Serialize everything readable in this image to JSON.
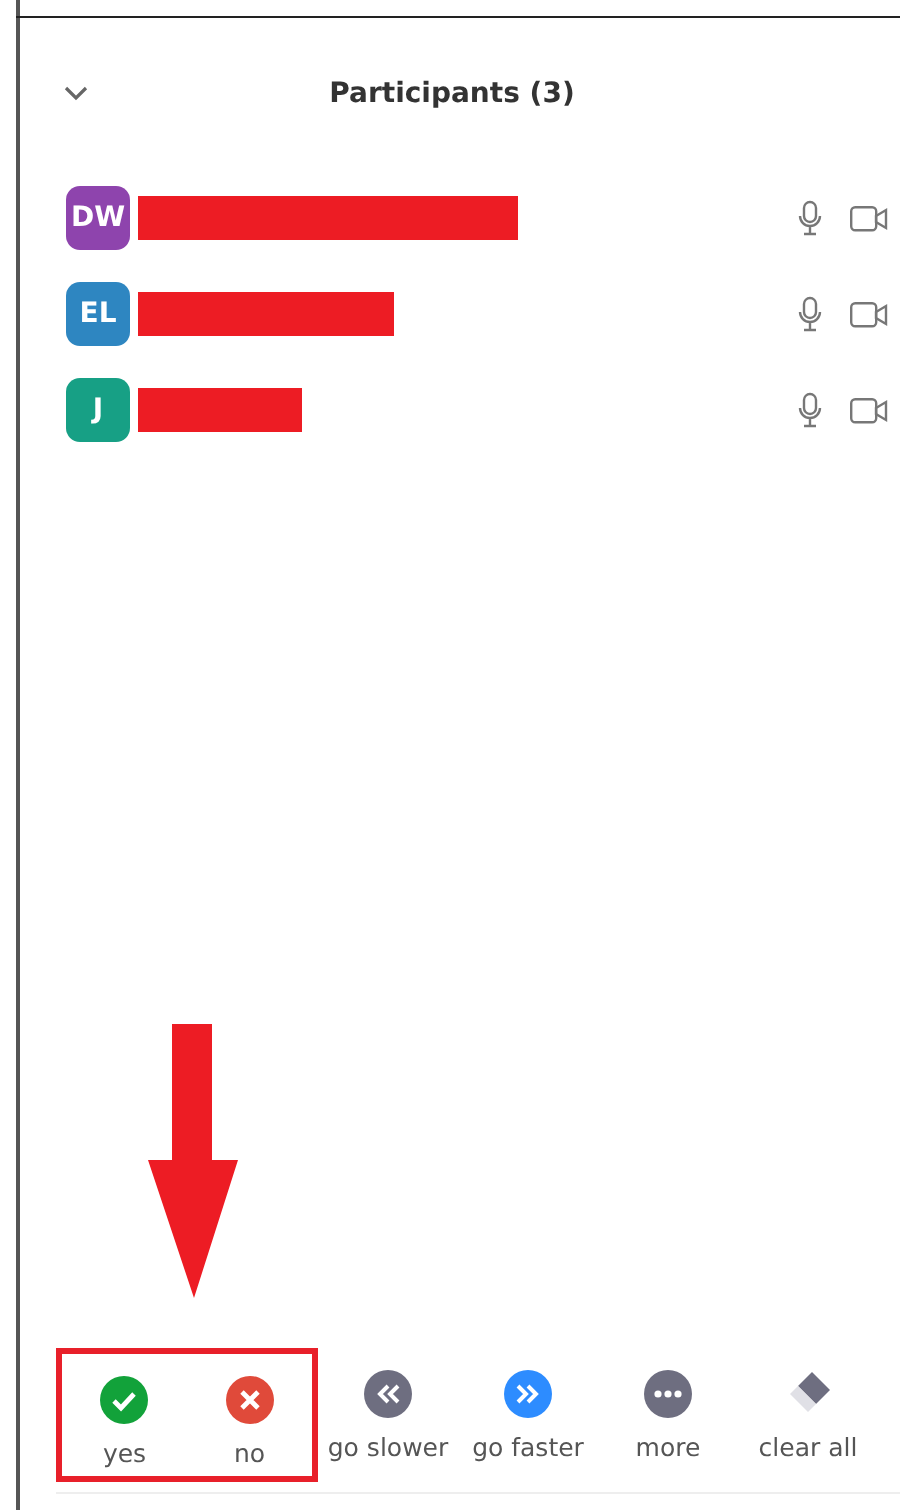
{
  "panel": {
    "title": "Participants (3)"
  },
  "participants": [
    {
      "initials": "DW",
      "color": "#8e44ad",
      "redacted": true
    },
    {
      "initials": "EL",
      "color": "#2e86c1",
      "redacted": true
    },
    {
      "initials": "J",
      "color": "#17a085",
      "redacted": true
    }
  ],
  "reactions": [
    {
      "kind": "yes",
      "label": "yes",
      "highlighted": true
    },
    {
      "kind": "no",
      "label": "no",
      "highlighted": true
    },
    {
      "kind": "slower",
      "label": "go slower",
      "highlighted": false
    },
    {
      "kind": "faster",
      "label": "go faster",
      "highlighted": false
    },
    {
      "kind": "more",
      "label": "more",
      "highlighted": false
    },
    {
      "kind": "clear",
      "label": "clear all",
      "highlighted": false
    }
  ]
}
